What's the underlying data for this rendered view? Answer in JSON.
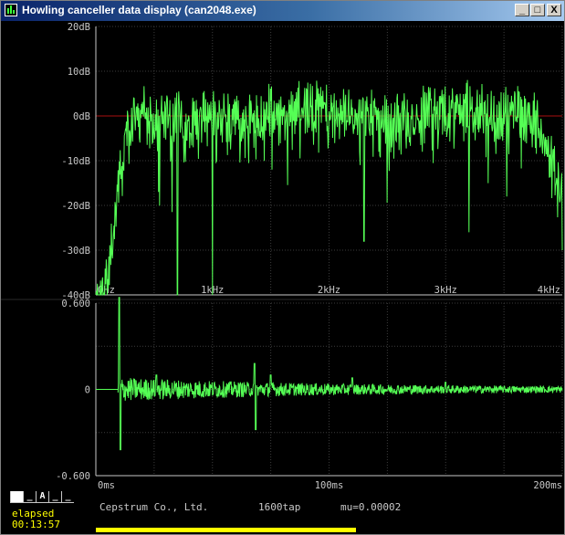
{
  "window": {
    "title": "Howling canceller data display (can2048.exe)",
    "buttons": {
      "minimize": "_",
      "maximize": "□",
      "close": "X"
    }
  },
  "colors": {
    "trace": "#55ff55",
    "grid": "#3c3c3c",
    "axis": "#c8c8c8",
    "zero_line": "#aa1111",
    "accent": "#ffff00"
  },
  "spectrum": {
    "y_labels": [
      "20dB",
      "10dB",
      "0dB",
      "-10dB",
      "-20dB",
      "-30dB",
      "-40dB"
    ],
    "x_labels": [
      "0Hz",
      "1kHz",
      "2kHz",
      "3kHz",
      "4kHz"
    ],
    "chart_data": {
      "type": "line",
      "xlabel": "",
      "ylabel": "",
      "xlim": [
        0,
        4000
      ],
      "ylim": [
        -40,
        20
      ],
      "unit_x": "Hz",
      "unit_y": "dB",
      "grid": true,
      "reference_line_y": 0,
      "x": [
        0,
        100,
        150,
        200,
        250,
        300,
        400,
        500,
        600,
        700,
        800,
        900,
        1000,
        1200,
        1400,
        1500,
        1600,
        1800,
        2000,
        2200,
        2400,
        2600,
        2800,
        3000,
        3200,
        3400,
        3600,
        3800,
        3900,
        4000
      ],
      "y": [
        -40,
        -35,
        -24,
        -10,
        -5,
        1,
        3,
        2,
        1,
        3,
        0,
        2,
        2,
        1,
        1,
        3,
        2,
        4,
        3,
        1,
        2,
        0,
        3,
        3,
        4,
        2,
        3,
        1,
        -7,
        -16
      ],
      "min_dips": [
        {
          "x": 700,
          "y": -40
        },
        {
          "x": 1000,
          "y": -40
        },
        {
          "x": 2300,
          "y": -28
        },
        {
          "x": 3200,
          "y": -26
        },
        {
          "x": 4000,
          "y": -30
        }
      ]
    }
  },
  "cepstrum": {
    "y_labels": [
      "0.600",
      "0",
      "-0.600"
    ],
    "x_labels": [
      "0ms",
      "100ms",
      "200ms"
    ],
    "chart_data": {
      "type": "line",
      "xlabel": "",
      "ylabel": "",
      "xlim": [
        0,
        200
      ],
      "ylim": [
        -0.6,
        0.6
      ],
      "unit_x": "ms",
      "grid": true,
      "peaks": [
        {
          "x": 10,
          "y": 0.64
        },
        {
          "x": 10.5,
          "y": -0.42
        },
        {
          "x": 26,
          "y": 0.1
        },
        {
          "x": 68,
          "y": 0.18
        },
        {
          "x": 68.5,
          "y": -0.28
        },
        {
          "x": 75,
          "y": 0.1
        },
        {
          "x": 110,
          "y": 0.08
        },
        {
          "x": 150,
          "y": 0.05
        }
      ]
    }
  },
  "status": {
    "company": "Cepstrum Co., Ltd.",
    "taps": "1600tap",
    "mu": "mu=0.00002",
    "elapsed_label": "elapsed",
    "elapsed_time": "00:13:57",
    "mode_buttons": [
      "_",
      "_",
      "A",
      "_",
      "_"
    ],
    "active_mode": 0
  }
}
